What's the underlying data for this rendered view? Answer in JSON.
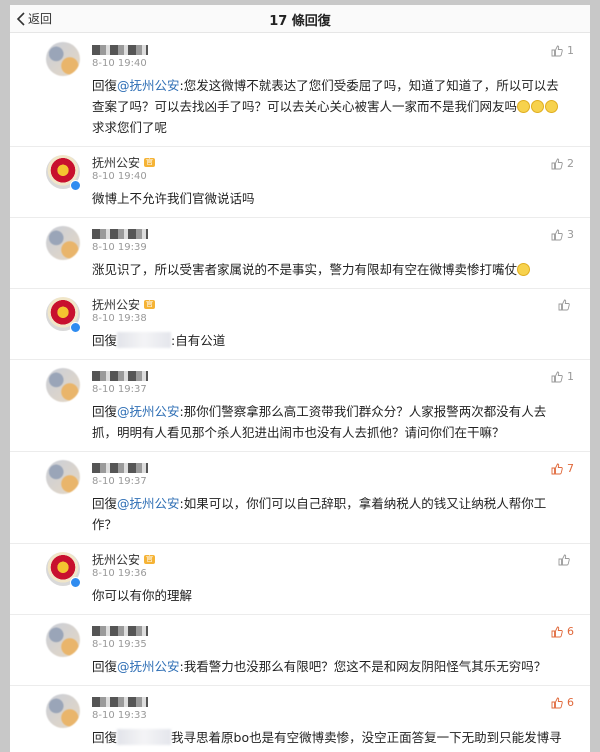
{
  "header": {
    "back_label": "返回",
    "title": "17 條回復"
  },
  "comments": [
    {
      "name": "",
      "badge": "",
      "time": "8-10 19:40",
      "likes": "1",
      "prefix": "回復",
      "mention": "@抚州公安",
      "masked": false,
      "text": ":您发这微博不就表达了您们受委屈了吗，知道了知道了，所以可以去查案了吗？可以去找凶手了吗？可以去关心关心被害人一家而不是我们网友吗",
      "suffix": "求求您们了呢",
      "emojis": 3
    },
    {
      "name": "抚州公安",
      "badge": "官",
      "time": "8-10 19:40",
      "likes": "2",
      "prefix": "",
      "mention": "",
      "masked": false,
      "text": "微博上不允许我们官微说话吗",
      "suffix": "",
      "emojis": 0
    },
    {
      "name": "",
      "badge": "",
      "time": "8-10 19:39",
      "likes": "3",
      "prefix": "",
      "mention": "",
      "masked": false,
      "text": "涨见识了，所以受害者家属说的不是事实，警力有限却有空在微博卖惨打嘴仗",
      "suffix": "",
      "emojis": 1
    },
    {
      "name": "抚州公安",
      "badge": "官",
      "time": "8-10 19:38",
      "likes": "",
      "prefix": "回復",
      "mention": "",
      "masked": true,
      "text": ":自有公道",
      "suffix": "",
      "emojis": 0
    },
    {
      "name": "",
      "badge": "",
      "time": "8-10 19:37",
      "likes": "1",
      "prefix": "回復",
      "mention": "@抚州公安",
      "masked": false,
      "text": ":那你们警察拿那么高工资带我们群众分？人家报警两次都没有人去抓，明明有人看见那个杀人犯进出闹市也没有人去抓他？请问你们在干嘛？",
      "suffix": "",
      "emojis": 0
    },
    {
      "name": "",
      "badge": "",
      "time": "8-10 19:37",
      "likes": "7",
      "prefix": "回復",
      "mention": "@抚州公安",
      "masked": false,
      "text": ":如果可以，你们可以自己辞职，拿着纳税人的钱又让纳税人帮你工作？",
      "suffix": "",
      "emojis": 0
    },
    {
      "name": "抚州公安",
      "badge": "官",
      "time": "8-10 19:36",
      "likes": "",
      "prefix": "",
      "mention": "",
      "masked": false,
      "text": "你可以有你的理解",
      "suffix": "",
      "emojis": 0
    },
    {
      "name": "",
      "badge": "",
      "time": "8-10 19:35",
      "likes": "6",
      "prefix": "回復",
      "mention": "@抚州公安",
      "masked": false,
      "text": ":我看警力也没那么有限吧？您这不是和网友阴阳怪气其乐无穷吗？",
      "suffix": "",
      "emojis": 0
    },
    {
      "name": "",
      "badge": "",
      "time": "8-10 19:33",
      "likes": "6",
      "prefix": "回復",
      "mention": "",
      "masked": true,
      "text": "我寻思着原bo也是有空微博卖惨，没空正面答复一下无助到只能发博寻找公道和正义的被害人一家，害～老双标了",
      "suffix": "",
      "emojis": 0
    }
  ],
  "colors": {
    "mention": "#2f6fb5",
    "hot_like": "#e0683a",
    "badge": "#f5b335",
    "verified": "#2f8cf0"
  }
}
